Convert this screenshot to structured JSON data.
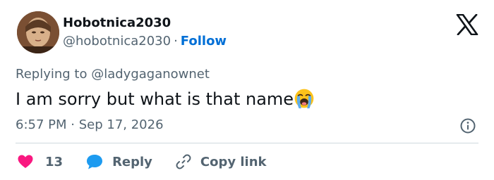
{
  "user": {
    "display_name": "Hobotnica2030",
    "handle": "@hobotnica2030",
    "separator": "·",
    "follow_label": "Follow"
  },
  "tweet": {
    "replying_prefix": "Replying to",
    "replying_to": "@ladygaganownet",
    "text": "I am sorry but what is that name",
    "emoji": "loudly-crying-face",
    "time": "6:57 PM",
    "separator": "·",
    "date": "Sep 17, 2026"
  },
  "actions": {
    "like_count": "13",
    "reply_label": "Reply",
    "copy_link_label": "Copy link"
  },
  "colors": {
    "text": "#0f1419",
    "secondary": "#536471",
    "follow_link": "#006fd6",
    "like": "#f91880",
    "reply": "#1d9bf0",
    "divider": "#cfd9de"
  },
  "icons": {
    "logo": "x-logo-icon",
    "info": "info-icon",
    "like": "heart-icon",
    "reply": "speech-bubble-icon",
    "copy": "link-icon"
  }
}
